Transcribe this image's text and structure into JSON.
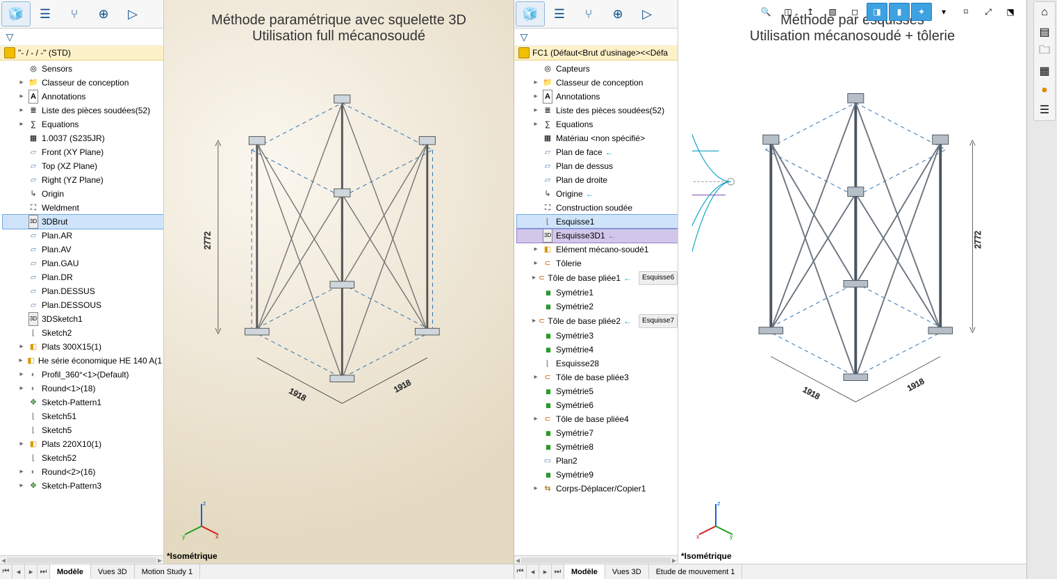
{
  "left": {
    "title_l1": "Méthode paramétrique avec squelette 3D",
    "title_l2": "Utilisation full mécanosoudé",
    "doc": "\"- / - / -\"  (STD)",
    "footer": "*Isométrique",
    "dims": {
      "h": "2772",
      "w1": "1918",
      "w2": "1918"
    },
    "tabs": [
      "Modèle",
      "Vues 3D",
      "Motion Study 1"
    ],
    "tree": [
      {
        "i": "ico-sens",
        "t": "Sensors",
        "ind": 1
      },
      {
        "i": "ico-folder",
        "t": "Classeur de conception",
        "ind": 1,
        "exp": "▸"
      },
      {
        "i": "ico-ann",
        "t": "Annotations",
        "ind": 1,
        "exp": "▸"
      },
      {
        "i": "ico-list",
        "t": "Liste des pièces soudées(52)",
        "ind": 1,
        "exp": "▸"
      },
      {
        "i": "ico-eq",
        "t": "Equations",
        "ind": 1,
        "exp": "▸"
      },
      {
        "i": "ico-mat",
        "t": "1.0037 (S235JR)",
        "ind": 1
      },
      {
        "i": "ico-plane",
        "t": "Front (XY Plane)",
        "ind": 1
      },
      {
        "i": "ico-plane",
        "t": "Top (XZ Plane)",
        "ind": 1
      },
      {
        "i": "ico-plane",
        "t": "Right (YZ Plane)",
        "ind": 1
      },
      {
        "i": "ico-origin",
        "t": "Origin",
        "ind": 1
      },
      {
        "i": "ico-weld",
        "t": "Weldment",
        "ind": 1
      },
      {
        "i": "ico-3d",
        "t": "3DBrut",
        "ind": 1,
        "sel": true
      },
      {
        "i": "ico-plane",
        "t": "Plan.AR",
        "ind": 1
      },
      {
        "i": "ico-plane",
        "t": "Plan.AV",
        "ind": 1
      },
      {
        "i": "ico-plane",
        "t": "Plan.GAU",
        "ind": 1
      },
      {
        "i": "ico-plane",
        "t": "Plan.DR",
        "ind": 1
      },
      {
        "i": "ico-plane",
        "t": "Plan.DESSUS",
        "ind": 1
      },
      {
        "i": "ico-plane",
        "t": "Plan.DESSOUS",
        "ind": 1
      },
      {
        "i": "ico-3d",
        "t": "3DSketch1",
        "ind": 1
      },
      {
        "i": "ico-sket",
        "t": "Sketch2",
        "ind": 1
      },
      {
        "i": "ico-box",
        "t": "Plats 300X15(1)",
        "ind": 1,
        "exp": "▸"
      },
      {
        "i": "ico-box",
        "t": "He série économique HE 140 A(1",
        "ind": 1,
        "exp": "▸"
      },
      {
        "i": "ico-round",
        "t": "Profil_360°<1>(Default)",
        "ind": 1,
        "exp": "▸"
      },
      {
        "i": "ico-round",
        "t": "Round<1>(18)",
        "ind": 1,
        "exp": "▸"
      },
      {
        "i": "ico-patt",
        "t": "Sketch-Pattern1",
        "ind": 1
      },
      {
        "i": "ico-sket",
        "t": "Sketch51",
        "ind": 1
      },
      {
        "i": "ico-sket",
        "t": "Sketch5",
        "ind": 1
      },
      {
        "i": "ico-box",
        "t": "Plats 220X10(1)",
        "ind": 1,
        "exp": "▸"
      },
      {
        "i": "ico-sket",
        "t": "Sketch52",
        "ind": 1
      },
      {
        "i": "ico-round",
        "t": "Round<2>(16)",
        "ind": 1,
        "exp": "▸"
      },
      {
        "i": "ico-patt",
        "t": "Sketch-Pattern3",
        "ind": 1,
        "exp": "▸"
      }
    ]
  },
  "right": {
    "title_l1": "Méthode par esquisses",
    "title_l2": "Utilisation mécanosoudé + tôlerie",
    "doc": "FC1  (Défaut<Brut d'usinage><<Défa",
    "footer": "*Isométrique",
    "dims": {
      "h": "2772",
      "w1": "1918",
      "w2": "1918"
    },
    "tabs": [
      "Modèle",
      "Vues 3D",
      "Etude de mouvement 1"
    ],
    "pill1": "Esquisse6",
    "pill2": "Esquisse7",
    "tree": [
      {
        "i": "ico-sens",
        "t": "Capteurs",
        "ind": 1
      },
      {
        "i": "ico-folder",
        "t": "Classeur de conception",
        "ind": 1,
        "exp": "▸"
      },
      {
        "i": "ico-ann",
        "t": "Annotations",
        "ind": 1,
        "exp": "▸"
      },
      {
        "i": "ico-list",
        "t": "Liste des pièces soudées(52)",
        "ind": 1,
        "exp": "▸"
      },
      {
        "i": "ico-eq",
        "t": "Equations",
        "ind": 1,
        "exp": "▸"
      },
      {
        "i": "ico-mat",
        "t": "Matériau <non spécifié>",
        "ind": 1
      },
      {
        "i": "ico-plane",
        "t": "Plan de face",
        "ind": 1,
        "arrow": "←"
      },
      {
        "i": "ico-plane",
        "t": "Plan de dessus",
        "ind": 1
      },
      {
        "i": "ico-plane",
        "t": "Plan de droite",
        "ind": 1
      },
      {
        "i": "ico-origin",
        "t": "Origine",
        "ind": 1,
        "arrow": "←"
      },
      {
        "i": "ico-weld",
        "t": "Construction soudée",
        "ind": 1
      },
      {
        "i": "ico-sket",
        "t": "Esquisse1",
        "ind": 1,
        "sel": true,
        "dash": true
      },
      {
        "i": "ico-3d",
        "t": "Esquisse3D1",
        "ind": 1,
        "sel2": true,
        "arrow": "←"
      },
      {
        "i": "ico-box",
        "t": "Elément mécano-soudé1",
        "ind": 1,
        "exp": "▸"
      },
      {
        "i": "ico-tol",
        "t": "Tôlerie",
        "ind": 1,
        "exp": "▸"
      },
      {
        "i": "ico-tol",
        "t": "Tôle de base pliée1",
        "ind": 1,
        "exp": "▸",
        "pill": "pill1",
        "arrow": "←"
      },
      {
        "i": "ico-sym",
        "t": "Symétrie1",
        "ind": 1
      },
      {
        "i": "ico-sym",
        "t": "Symétrie2",
        "ind": 1
      },
      {
        "i": "ico-tol",
        "t": "Tôle de base pliée2",
        "ind": 1,
        "exp": "▸",
        "pill": "pill2",
        "arrow": "←"
      },
      {
        "i": "ico-sym",
        "t": "Symétrie3",
        "ind": 1
      },
      {
        "i": "ico-sym",
        "t": "Symétrie4",
        "ind": 1
      },
      {
        "i": "ico-sket",
        "t": "Esquisse28",
        "ind": 1
      },
      {
        "i": "ico-tol",
        "t": "Tôle de base pliée3",
        "ind": 1,
        "exp": "▸"
      },
      {
        "i": "ico-sym",
        "t": "Symétrie5",
        "ind": 1
      },
      {
        "i": "ico-sym",
        "t": "Symétrie6",
        "ind": 1
      },
      {
        "i": "ico-tol",
        "t": "Tôle de base pliée4",
        "ind": 1,
        "exp": "▸"
      },
      {
        "i": "ico-sym",
        "t": "Symétrie7",
        "ind": 1
      },
      {
        "i": "ico-sym",
        "t": "Symétrie8",
        "ind": 1
      },
      {
        "i": "ico-plan2",
        "t": "Plan2",
        "ind": 1
      },
      {
        "i": "ico-sym",
        "t": "Symétrie9",
        "ind": 1
      },
      {
        "i": "ico-cd",
        "t": "Corps-Déplacer/Copier1",
        "ind": 1,
        "exp": "▸"
      }
    ]
  },
  "sidebar_right": [
    "home-icon",
    "layers-icon",
    "folder-icon",
    "grid-icon",
    "appearance-icon",
    "properties-icon"
  ]
}
